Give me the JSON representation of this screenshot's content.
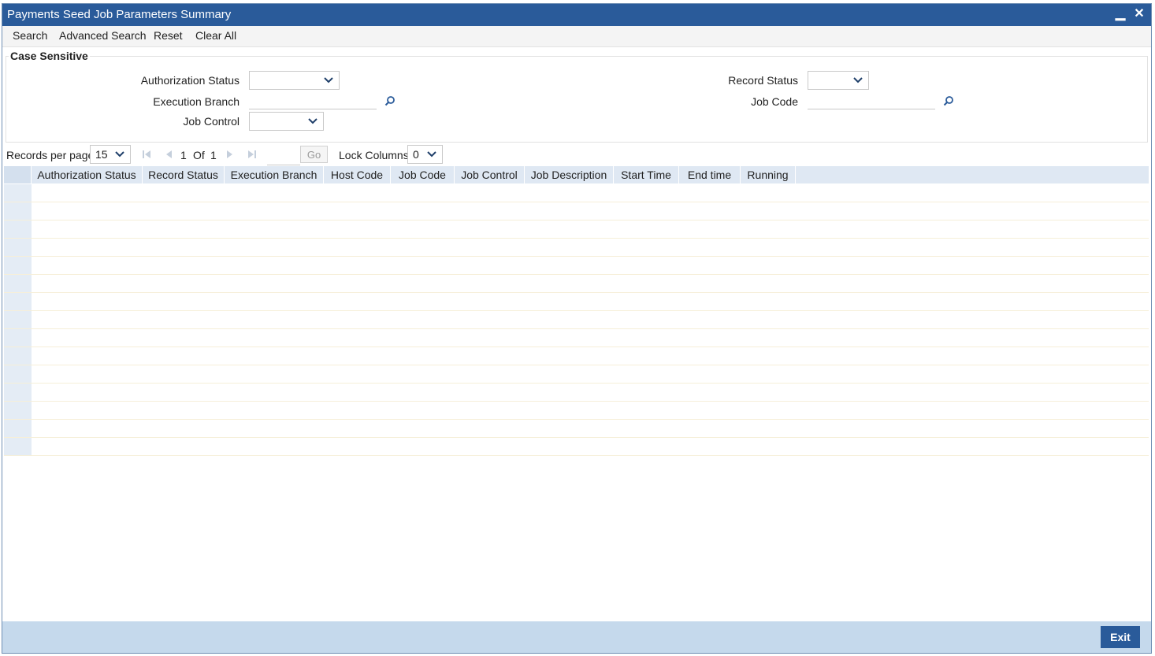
{
  "window": {
    "title": "Payments Seed Job Parameters Summary",
    "minimize": "▁",
    "close": "✕"
  },
  "toolbar": {
    "search": "Search",
    "advanced_search": "Advanced Search",
    "reset": "Reset",
    "clear_all": "Clear All"
  },
  "criteria": {
    "legend": "Case Sensitive",
    "authorization_status_label": "Authorization Status",
    "authorization_status_value": "",
    "execution_branch_label": "Execution Branch",
    "execution_branch_value": "",
    "job_control_label": "Job Control",
    "job_control_value": "",
    "record_status_label": "Record Status",
    "record_status_value": "",
    "job_code_label": "Job Code",
    "job_code_value": ""
  },
  "pager": {
    "records_per_page_label": "Records per page",
    "records_per_page": "15",
    "current_page": "1",
    "of_label": "Of",
    "total_pages": "1",
    "go_label": "Go",
    "lock_columns_label": "Lock Columns",
    "lock_columns": "0"
  },
  "grid": {
    "columns": [
      "Authorization Status",
      "Record Status",
      "Execution Branch",
      "Host Code",
      "Job Code",
      "Job Control",
      "Job Description",
      "Start Time",
      "End time",
      "Running"
    ],
    "rows": 15
  },
  "footer": {
    "exit": "Exit"
  },
  "colors": {
    "titlebar": "#2a5b9a",
    "footer": "#c5d9ec",
    "grid_header": "#dfe8f3"
  }
}
